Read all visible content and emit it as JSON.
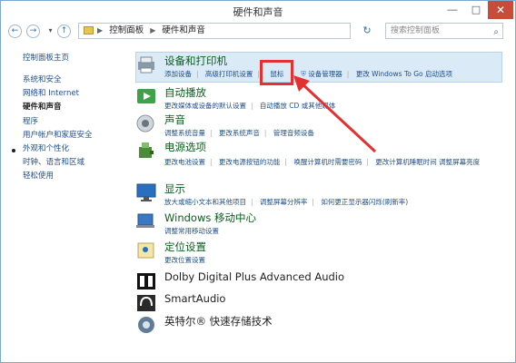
{
  "window": {
    "title": "硬件和声音",
    "min_icon": "minimize-icon",
    "max_icon": "maximize-icon",
    "close_icon": "close-icon"
  },
  "address": {
    "crumbs": [
      "控制面板",
      "硬件和声音"
    ],
    "search_placeholder": "搜索控制面板"
  },
  "sidebar": {
    "items": [
      {
        "label": "控制面板主页"
      },
      {
        "label": "系统和安全"
      },
      {
        "label": "网络和 Internet"
      },
      {
        "label": "硬件和声音"
      },
      {
        "label": "程序"
      },
      {
        "label": "用户帐户和家庭安全"
      },
      {
        "label": "外观和个性化"
      },
      {
        "label": "时钟、语言和区域"
      },
      {
        "label": "轻松使用"
      }
    ]
  },
  "categories": [
    {
      "title": "设备和打印机",
      "icon": "printer-icon",
      "links": [
        "添加设备",
        "高级打印机设置",
        "鼠标",
        "设备管理器",
        "更改 Windows To Go 启动选项"
      ]
    },
    {
      "title": "自动播放",
      "icon": "autoplay-icon",
      "links": [
        "更改媒体或设备的默认设置",
        "自动播放 CD 或其他媒体"
      ]
    },
    {
      "title": "声音",
      "icon": "sound-icon",
      "links": [
        "调整系统音量",
        "更改系统声音",
        "管理音频设备"
      ]
    },
    {
      "title": "电源选项",
      "icon": "power-icon",
      "links": [
        "更改电池设置",
        "更改电源按钮的功能",
        "唤醒计算机时需要密码",
        "更改计算机睡眠时间"
      ],
      "links2": [
        "调整屏幕亮度"
      ]
    },
    {
      "title": "显示",
      "icon": "display-icon",
      "links": [
        "放大或缩小文本和其他项目",
        "调整屏幕分辨率",
        "如何更正显示器闪烁(刷新率)"
      ]
    },
    {
      "title": "Windows 移动中心",
      "icon": "mobility-icon",
      "links": [
        "调整常用移动设置"
      ]
    },
    {
      "title": "定位设置",
      "icon": "location-icon",
      "links": [
        "更改位置设置"
      ]
    },
    {
      "title": "Dolby Digital Plus Advanced Audio",
      "icon": "dolby-icon",
      "links": []
    },
    {
      "title": "SmartAudio",
      "icon": "smartaudio-icon",
      "links": []
    },
    {
      "title": "英特尔® 快速存储技术",
      "icon": "intel-storage-icon",
      "links": []
    }
  ]
}
